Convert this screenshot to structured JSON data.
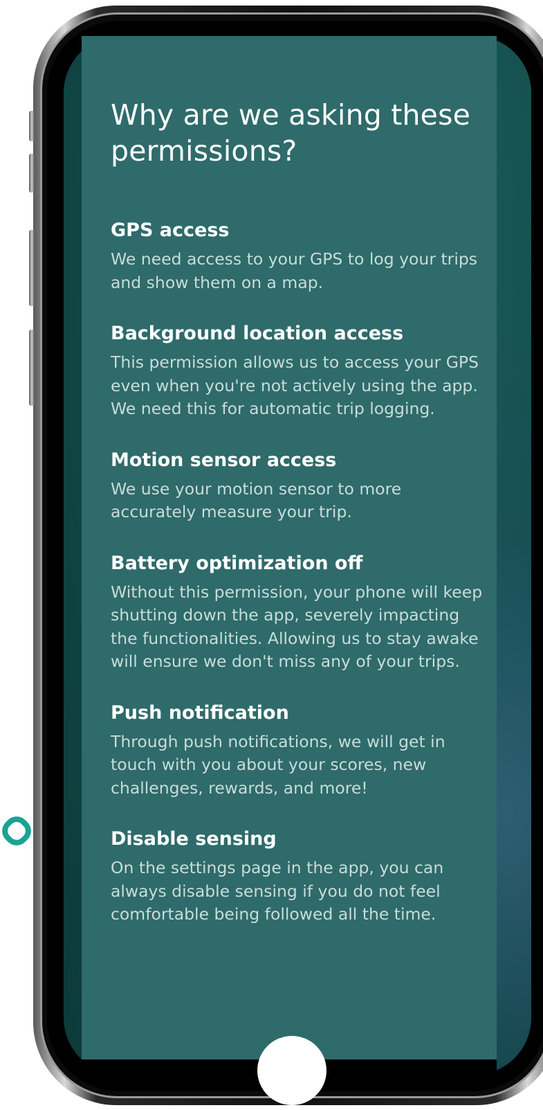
{
  "screen": {
    "title": "Why are we asking these permissions?",
    "sections": [
      {
        "heading": "GPS access",
        "body": "We need access to your GPS to log your trips and show them on a map."
      },
      {
        "heading": "Background location access",
        "body": "This permission allows us to access your GPS even when you're not actively using the app. We need this for automatic trip logging."
      },
      {
        "heading": "Motion sensor access",
        "body": "We use your motion sensor to more accurately measure your trip."
      },
      {
        "heading": "Battery optimization off",
        "body": "Without this permission, your phone will keep shutting down the app, severely impacting the functionalities. Allowing us to stay awake will ensure we don't miss any of your trips."
      },
      {
        "heading": "Push notification",
        "body": "Through push notifications, we will get in touch with you about your scores, new challenges, rewards, and more!"
      },
      {
        "heading": "Disable sensing",
        "body": "On the settings page in the app, you can always disable sensing if you do not feel comfortable being followed all the time."
      }
    ]
  },
  "colors": {
    "card_background": "#2e6b6a",
    "screen_background": "#134f4d",
    "heading_text": "#ffffff",
    "body_text": "#c8dcda",
    "brand_accent": "#1aa394"
  },
  "icons": {
    "brand_logo": "ring-logo-icon"
  }
}
